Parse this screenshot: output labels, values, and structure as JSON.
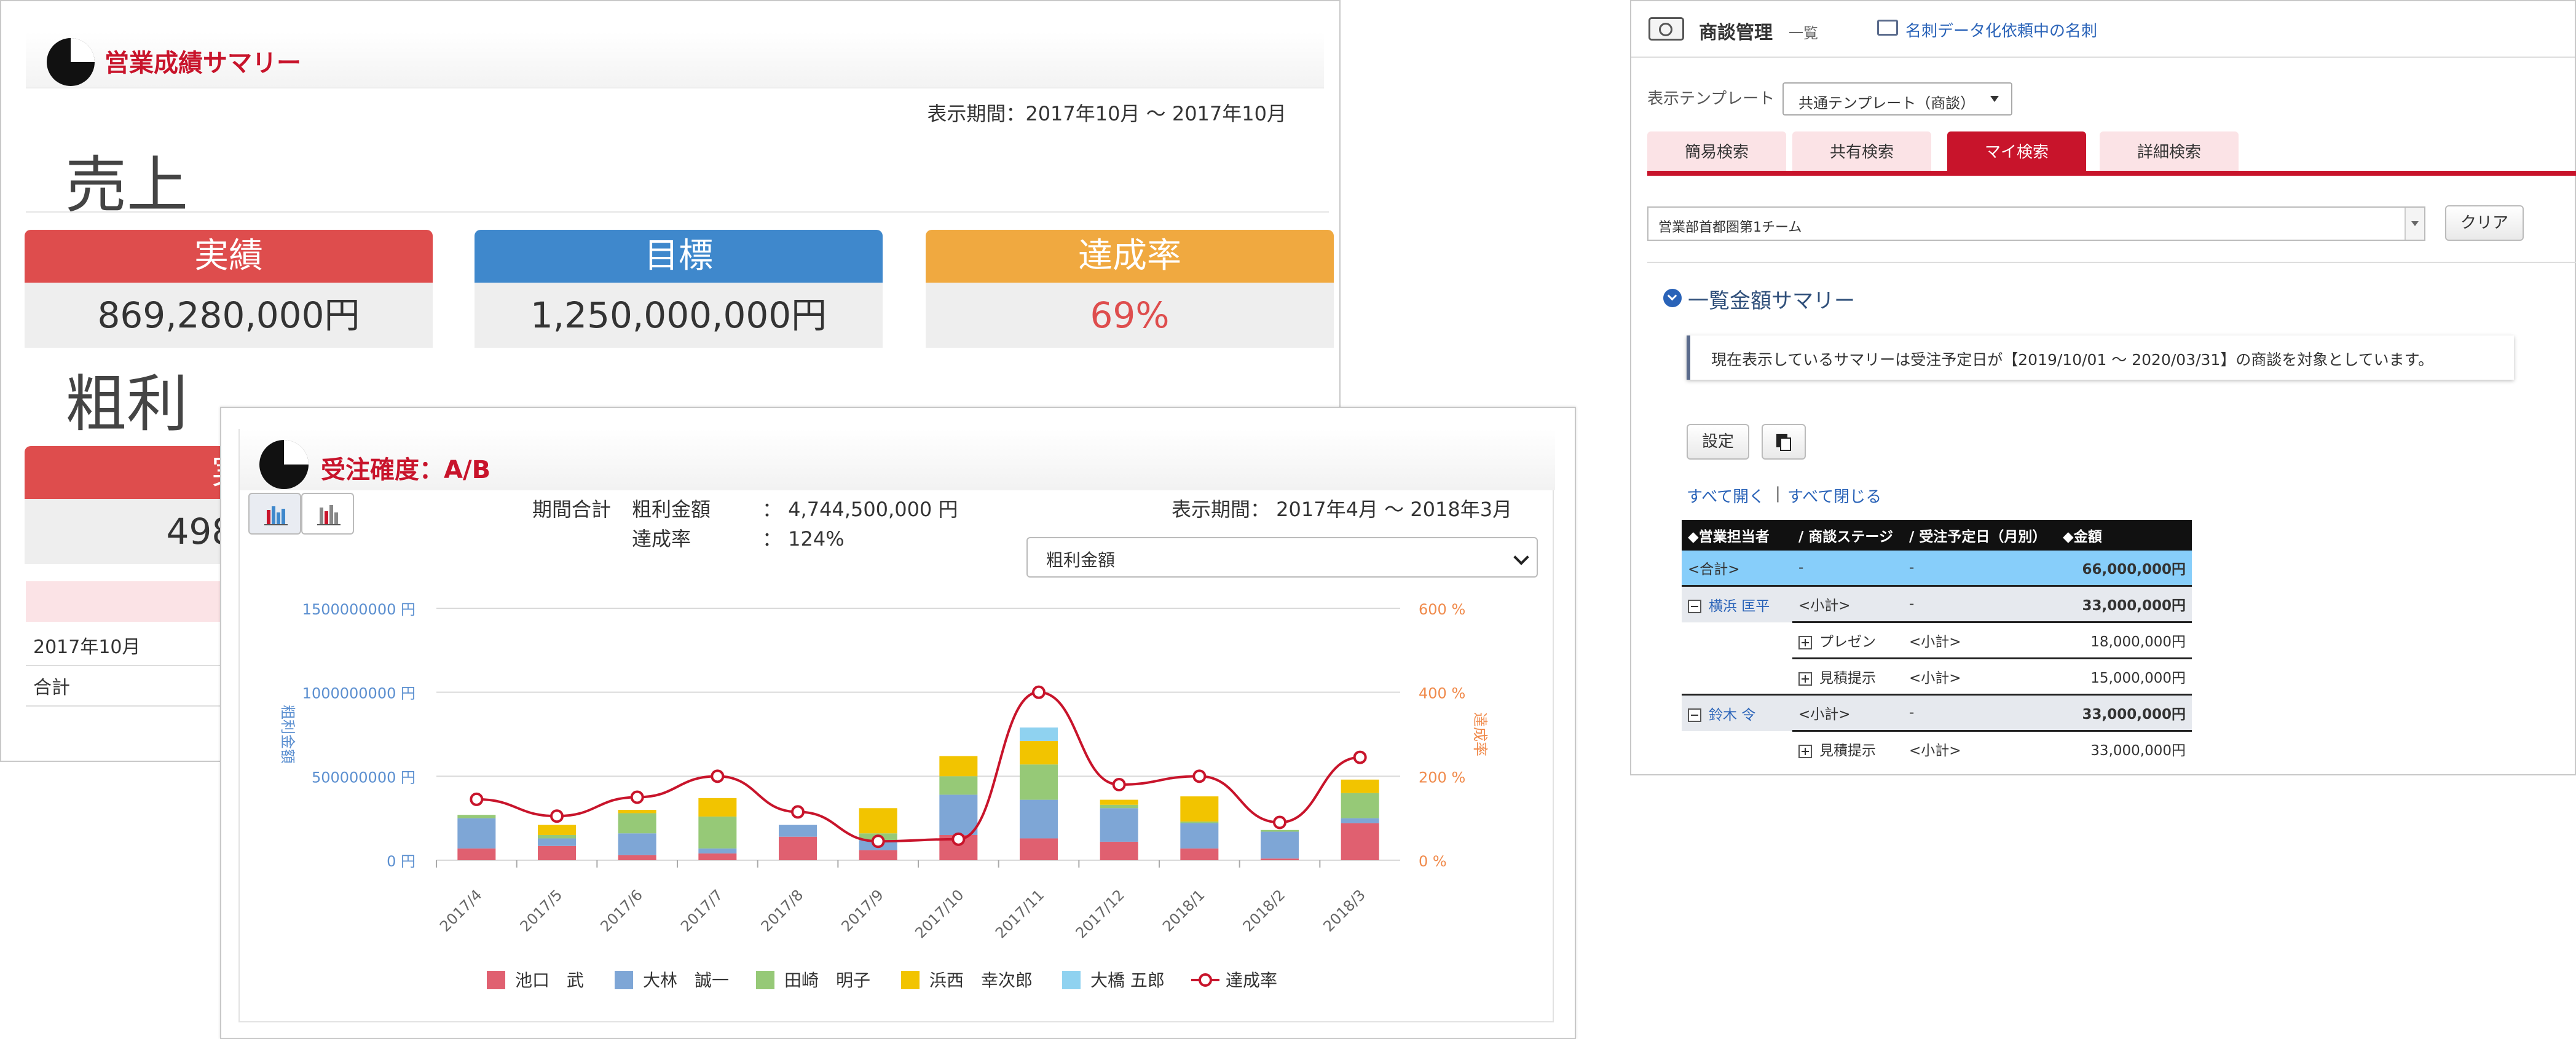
{
  "sales_summary": {
    "title": "営業成績サマリー",
    "period": "表示期間：2017年10月 ～ 2017年10月",
    "sales_heading": "売上",
    "cards": [
      {
        "label": "実績",
        "value": "869,280,000円",
        "color": "#de4d4d"
      },
      {
        "label": "目標",
        "value": "1,250,000,000円",
        "color": "#3f88cc"
      },
      {
        "label": "達成率",
        "value": "69%",
        "color": "#f0a940"
      }
    ],
    "gross_heading": "粗利",
    "gross_card_label": "実",
    "gross_card_value": "498,15",
    "table_rows": [
      "2017年10月",
      "合計"
    ]
  },
  "chart_panel": {
    "title": "受注確度：A/B",
    "period_total_label": "期間合計",
    "gross_amount_label": "粗利金額",
    "gross_amount_value": "：  4,744,500,000 円",
    "achievement_label": "達成率",
    "achievement_value": "：  124%",
    "period": "表示期間： 2017年4月 ～ 2018年3月",
    "metric_select": "粗利金額"
  },
  "chart_data": {
    "type": "bar",
    "stacked": true,
    "categories": [
      "2017/4",
      "2017/5",
      "2017/6",
      "2017/7",
      "2017/8",
      "2017/9",
      "2017/10",
      "2017/11",
      "2017/12",
      "2018/1",
      "2018/2",
      "2018/3"
    ],
    "ylabel": "粗利金額",
    "y2label": "達成率",
    "ylim": [
      0,
      1500000000
    ],
    "y2lim": [
      0,
      600
    ],
    "yticks": [
      "0 円",
      "500000000 円",
      "1000000000 円",
      "1500000000 円"
    ],
    "y2ticks": [
      "0 %",
      "200 %",
      "400 %",
      "600 %"
    ],
    "series": [
      {
        "name": "池口　武",
        "color": "#e06070",
        "values": [
          70000000,
          85000000,
          30000000,
          40000000,
          140000000,
          60000000,
          150000000,
          130000000,
          110000000,
          70000000,
          10000000,
          220000000
        ]
      },
      {
        "name": "大林　誠一",
        "color": "#7ea6d6",
        "values": [
          180000000,
          45000000,
          130000000,
          30000000,
          70000000,
          60000000,
          240000000,
          230000000,
          200000000,
          150000000,
          160000000,
          30000000
        ]
      },
      {
        "name": "田崎　明子",
        "color": "#96c977",
        "values": [
          20000000,
          20000000,
          120000000,
          190000000,
          0,
          40000000,
          110000000,
          210000000,
          20000000,
          10000000,
          10000000,
          150000000
        ]
      },
      {
        "name": "浜西　幸次郎",
        "color": "#f2c400",
        "values": [
          0,
          60000000,
          20000000,
          110000000,
          0,
          150000000,
          120000000,
          140000000,
          30000000,
          150000000,
          0,
          80000000
        ]
      },
      {
        "name": "大橋 五郎",
        "color": "#8fd2f0",
        "values": [
          0,
          0,
          0,
          0,
          0,
          0,
          0,
          80000000,
          0,
          0,
          0,
          0
        ]
      }
    ],
    "line": {
      "name": "達成率",
      "color": "#c8142b",
      "values": [
        145,
        105,
        150,
        200,
        115,
        45,
        50,
        400,
        180,
        200,
        90,
        245
      ]
    },
    "legend_position": "bottom"
  },
  "deals": {
    "title": "商談管理",
    "title_suffix": "一覧",
    "card_link": "名刺データ化依頼中の名刺",
    "template_label": "表示テンプレート",
    "template_value": "共通テンプレート（商談）",
    "tabs": [
      "簡易検索",
      "共有検索",
      "マイ検索",
      "詳細検索"
    ],
    "team_select": "営業部首都圏第1チーム",
    "clear_button": "クリア",
    "summary_heading": "一覧金額サマリー",
    "note": "現在表示しているサマリーは受注予定日が【2019/10/01 ～ 2020/03/31】の商談を対象としています。",
    "settings_button": "設定",
    "expand_all": "すべて開く",
    "divider": "|",
    "collapse_all": "すべて閉じる",
    "table": {
      "headers": [
        "◆営業担当者",
        "/ 商談ステージ",
        "/ 受注予定日（月別）",
        "◆金額"
      ],
      "total": [
        "<合計>",
        "-",
        "-",
        "66,000,000円"
      ],
      "rows": [
        {
          "owner": "横浜 匡平",
          "stage": "<小計>",
          "date": "-",
          "amount": "33,000,000円",
          "children": [
            {
              "stage": "プレゼン",
              "date": "<小計>",
              "amount": "18,000,000円"
            },
            {
              "stage": "見積提示",
              "date": "<小計>",
              "amount": "15,000,000円"
            }
          ]
        },
        {
          "owner": "鈴木 令",
          "stage": "<小計>",
          "date": "-",
          "amount": "33,000,000円",
          "children": [
            {
              "stage": "見積提示",
              "date": "<小計>",
              "amount": "33,000,000円"
            }
          ]
        }
      ]
    }
  }
}
